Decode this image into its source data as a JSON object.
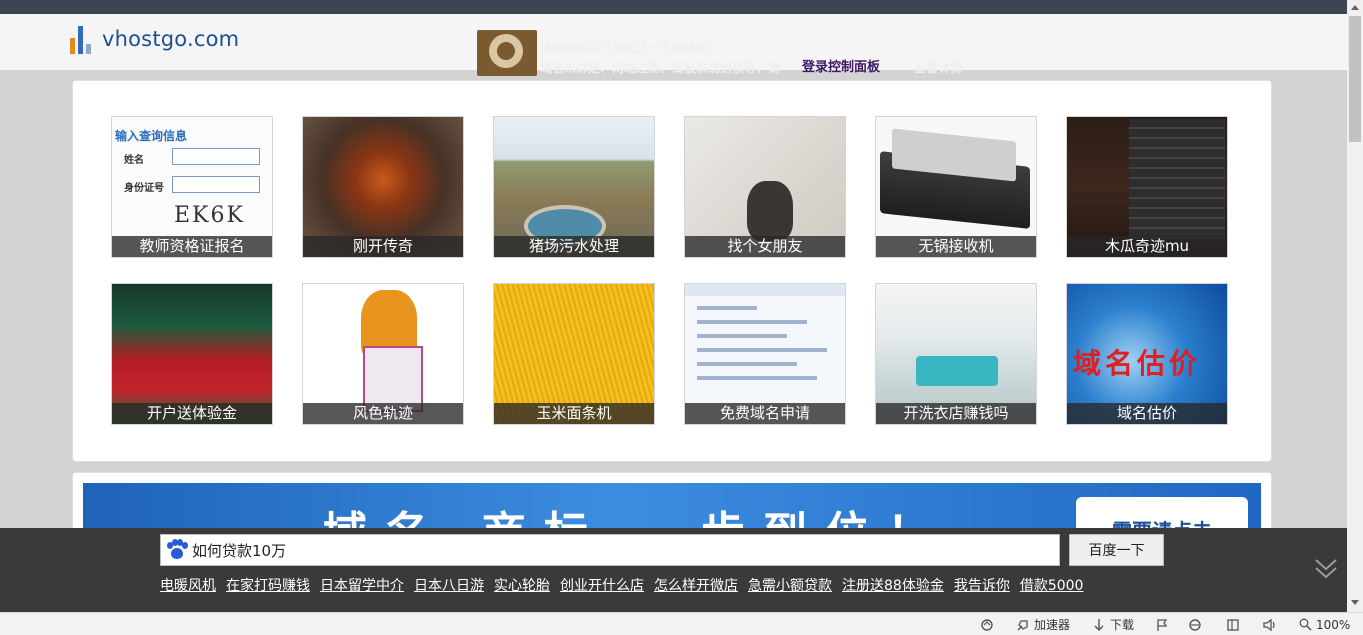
{
  "header": {
    "logo_text": "vhostgo.com",
    "notice_line1": "该网站因以下原因之一不能访问:",
    "notice_line2": "域名未绑定、网站过期、或被系统封禁等，请",
    "login_link": "登录控制面板",
    "notice_tail": "查看详情"
  },
  "tiles": [
    {
      "label": "教师资格证报名",
      "form_title": "输入查询信息",
      "field1": "姓名",
      "field2": "身份证号",
      "captcha": "EK6K"
    },
    {
      "label": "刚开传奇"
    },
    {
      "label": "猪场污水处理"
    },
    {
      "label": "找个女朋友"
    },
    {
      "label": "无锅接收机"
    },
    {
      "label": "木瓜奇迹mu"
    },
    {
      "label": "开户送体验金"
    },
    {
      "label": "风色轨迹"
    },
    {
      "label": "玉米面条机"
    },
    {
      "label": "免费域名申请"
    },
    {
      "label": "开洗衣店赚钱吗"
    },
    {
      "label": "域名估价",
      "overlay_text": "域名估价"
    }
  ],
  "banner": {
    "headline": "域名·商标 一步到位！",
    "button_label": "需要请点击"
  },
  "search": {
    "query": "如何贷款10万",
    "button_label": "百度一下",
    "hot_links": [
      "电暖风机",
      "在家打码赚钱",
      "日本留学中介",
      "日本八日游",
      "实心轮胎",
      "创业开什么店",
      "怎么样开微店",
      "急需小额贷款",
      "注册送88体验金",
      "我告诉你",
      "借款5000"
    ]
  },
  "statusbar": {
    "accelerator": "加速器",
    "download": "下载",
    "zoom": "100%"
  },
  "colors": {
    "topbar": "#3d4553",
    "logo_blue": "#1d4f91",
    "search_bar": "#3a3a3a",
    "baidu_blue": "#2a5bd7"
  }
}
